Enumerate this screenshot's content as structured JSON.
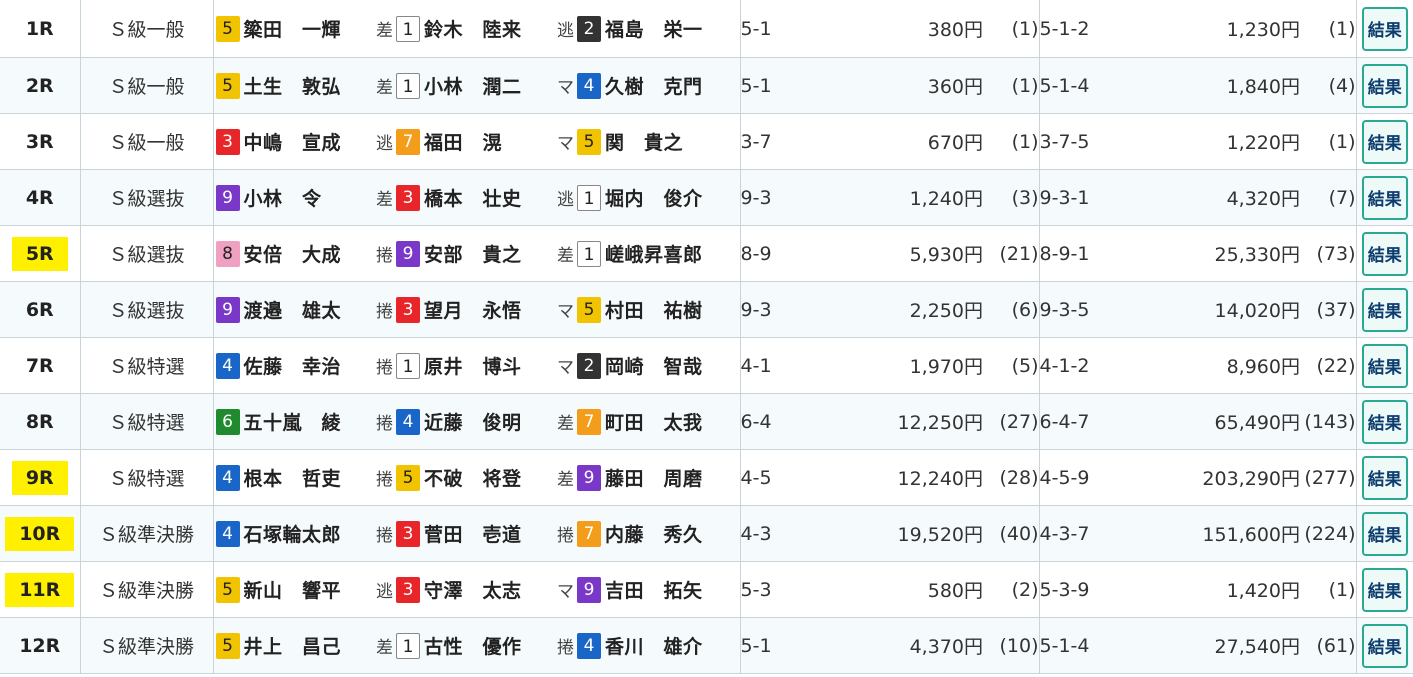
{
  "races": [
    {
      "race": "1R",
      "highlight": false,
      "class": "Ｓ級一般",
      "r1": {
        "num": "5",
        "color": "c5",
        "name": "簗田　一輝",
        "tactic": "差"
      },
      "r2": {
        "num": "1",
        "color": "c1",
        "name": "鈴木　陸来",
        "tactic": "逃"
      },
      "r3": {
        "num": "2",
        "color": "c2",
        "name": "福島　栄一"
      },
      "combo2": "5-1",
      "pay2": "380円",
      "pop2": "(1)",
      "combo3": "5-1-2",
      "pay3": "1,230円",
      "pop3": "(1)",
      "button": "結果"
    },
    {
      "race": "2R",
      "highlight": false,
      "class": "Ｓ級一般",
      "r1": {
        "num": "5",
        "color": "c5",
        "name": "土生　敦弘",
        "tactic": "差"
      },
      "r2": {
        "num": "1",
        "color": "c1",
        "name": "小林　潤二",
        "tactic": "マ"
      },
      "r3": {
        "num": "4",
        "color": "c4",
        "name": "久樹　克門"
      },
      "combo2": "5-1",
      "pay2": "360円",
      "pop2": "(1)",
      "combo3": "5-1-4",
      "pay3": "1,840円",
      "pop3": "(4)",
      "button": "結果"
    },
    {
      "race": "3R",
      "highlight": false,
      "class": "Ｓ級一般",
      "r1": {
        "num": "3",
        "color": "c3",
        "name": "中嶋　宣成",
        "tactic": "逃"
      },
      "r2": {
        "num": "7",
        "color": "c7",
        "name": "福田　滉",
        "tactic": "マ"
      },
      "r3": {
        "num": "5",
        "color": "c5",
        "name": "関　貴之"
      },
      "combo2": "3-7",
      "pay2": "670円",
      "pop2": "(1)",
      "combo3": "3-7-5",
      "pay3": "1,220円",
      "pop3": "(1)",
      "button": "結果"
    },
    {
      "race": "4R",
      "highlight": false,
      "class": "Ｓ級選抜",
      "r1": {
        "num": "9",
        "color": "c9",
        "name": "小林　令",
        "tactic": "差"
      },
      "r2": {
        "num": "3",
        "color": "c3",
        "name": "橋本　壮史",
        "tactic": "逃"
      },
      "r3": {
        "num": "1",
        "color": "c1",
        "name": "堀内　俊介"
      },
      "combo2": "9-3",
      "pay2": "1,240円",
      "pop2": "(3)",
      "combo3": "9-3-1",
      "pay3": "4,320円",
      "pop3": "(7)",
      "button": "結果"
    },
    {
      "race": "5R",
      "highlight": true,
      "class": "Ｓ級選抜",
      "r1": {
        "num": "8",
        "color": "c8",
        "name": "安倍　大成",
        "tactic": "捲"
      },
      "r2": {
        "num": "9",
        "color": "c9",
        "name": "安部　貴之",
        "tactic": "差"
      },
      "r3": {
        "num": "1",
        "color": "c1",
        "name": "嵯峨昇喜郎"
      },
      "combo2": "8-9",
      "pay2": "5,930円",
      "pop2": "(21)",
      "combo3": "8-9-1",
      "pay3": "25,330円",
      "pop3": "(73)",
      "button": "結果"
    },
    {
      "race": "6R",
      "highlight": false,
      "class": "Ｓ級選抜",
      "r1": {
        "num": "9",
        "color": "c9",
        "name": "渡邉　雄太",
        "tactic": "捲"
      },
      "r2": {
        "num": "3",
        "color": "c3",
        "name": "望月　永悟",
        "tactic": "マ"
      },
      "r3": {
        "num": "5",
        "color": "c5",
        "name": "村田　祐樹"
      },
      "combo2": "9-3",
      "pay2": "2,250円",
      "pop2": "(6)",
      "combo3": "9-3-5",
      "pay3": "14,020円",
      "pop3": "(37)",
      "button": "結果"
    },
    {
      "race": "7R",
      "highlight": false,
      "class": "Ｓ級特選",
      "r1": {
        "num": "4",
        "color": "c4",
        "name": "佐藤　幸治",
        "tactic": "捲"
      },
      "r2": {
        "num": "1",
        "color": "c1",
        "name": "原井　博斗",
        "tactic": "マ"
      },
      "r3": {
        "num": "2",
        "color": "c2",
        "name": "岡崎　智哉"
      },
      "combo2": "4-1",
      "pay2": "1,970円",
      "pop2": "(5)",
      "combo3": "4-1-2",
      "pay3": "8,960円",
      "pop3": "(22)",
      "button": "結果"
    },
    {
      "race": "8R",
      "highlight": false,
      "class": "Ｓ級特選",
      "r1": {
        "num": "6",
        "color": "c6",
        "name": "五十嵐　綾",
        "tactic": "捲"
      },
      "r2": {
        "num": "4",
        "color": "c4",
        "name": "近藤　俊明",
        "tactic": "差"
      },
      "r3": {
        "num": "7",
        "color": "c7",
        "name": "町田　太我"
      },
      "combo2": "6-4",
      "pay2": "12,250円",
      "pop2": "(27)",
      "combo3": "6-4-7",
      "pay3": "65,490円",
      "pop3": "(143)",
      "button": "結果"
    },
    {
      "race": "9R",
      "highlight": true,
      "class": "Ｓ級特選",
      "r1": {
        "num": "4",
        "color": "c4",
        "name": "根本　哲吏",
        "tactic": "捲"
      },
      "r2": {
        "num": "5",
        "color": "c5",
        "name": "不破　将登",
        "tactic": "差"
      },
      "r3": {
        "num": "9",
        "color": "c9",
        "name": "藤田　周磨"
      },
      "combo2": "4-5",
      "pay2": "12,240円",
      "pop2": "(28)",
      "combo3": "4-5-9",
      "pay3": "203,290円",
      "pop3": "(277)",
      "button": "結果"
    },
    {
      "race": "10R",
      "highlight": true,
      "class": "Ｓ級準決勝",
      "r1": {
        "num": "4",
        "color": "c4",
        "name": "石塚輪太郎",
        "tactic": "捲"
      },
      "r2": {
        "num": "3",
        "color": "c3",
        "name": "菅田　壱道",
        "tactic": "捲"
      },
      "r3": {
        "num": "7",
        "color": "c7",
        "name": "内藤　秀久"
      },
      "combo2": "4-3",
      "pay2": "19,520円",
      "pop2": "(40)",
      "combo3": "4-3-7",
      "pay3": "151,600円",
      "pop3": "(224)",
      "button": "結果"
    },
    {
      "race": "11R",
      "highlight": true,
      "class": "Ｓ級準決勝",
      "r1": {
        "num": "5",
        "color": "c5",
        "name": "新山　響平",
        "tactic": "逃"
      },
      "r2": {
        "num": "3",
        "color": "c3",
        "name": "守澤　太志",
        "tactic": "マ"
      },
      "r3": {
        "num": "9",
        "color": "c9",
        "name": "吉田　拓矢"
      },
      "combo2": "5-3",
      "pay2": "580円",
      "pop2": "(2)",
      "combo3": "5-3-9",
      "pay3": "1,420円",
      "pop3": "(1)",
      "button": "結果"
    },
    {
      "race": "12R",
      "highlight": false,
      "class": "Ｓ級準決勝",
      "r1": {
        "num": "5",
        "color": "c5",
        "name": "井上　昌己",
        "tactic": "差"
      },
      "r2": {
        "num": "1",
        "color": "c1",
        "name": "古性　優作",
        "tactic": "捲"
      },
      "r3": {
        "num": "4",
        "color": "c4",
        "name": "香川　雄介"
      },
      "combo2": "5-1",
      "pay2": "4,370円",
      "pop2": "(10)",
      "combo3": "5-1-4",
      "pay3": "27,540円",
      "pop3": "(61)",
      "button": "結果"
    }
  ]
}
